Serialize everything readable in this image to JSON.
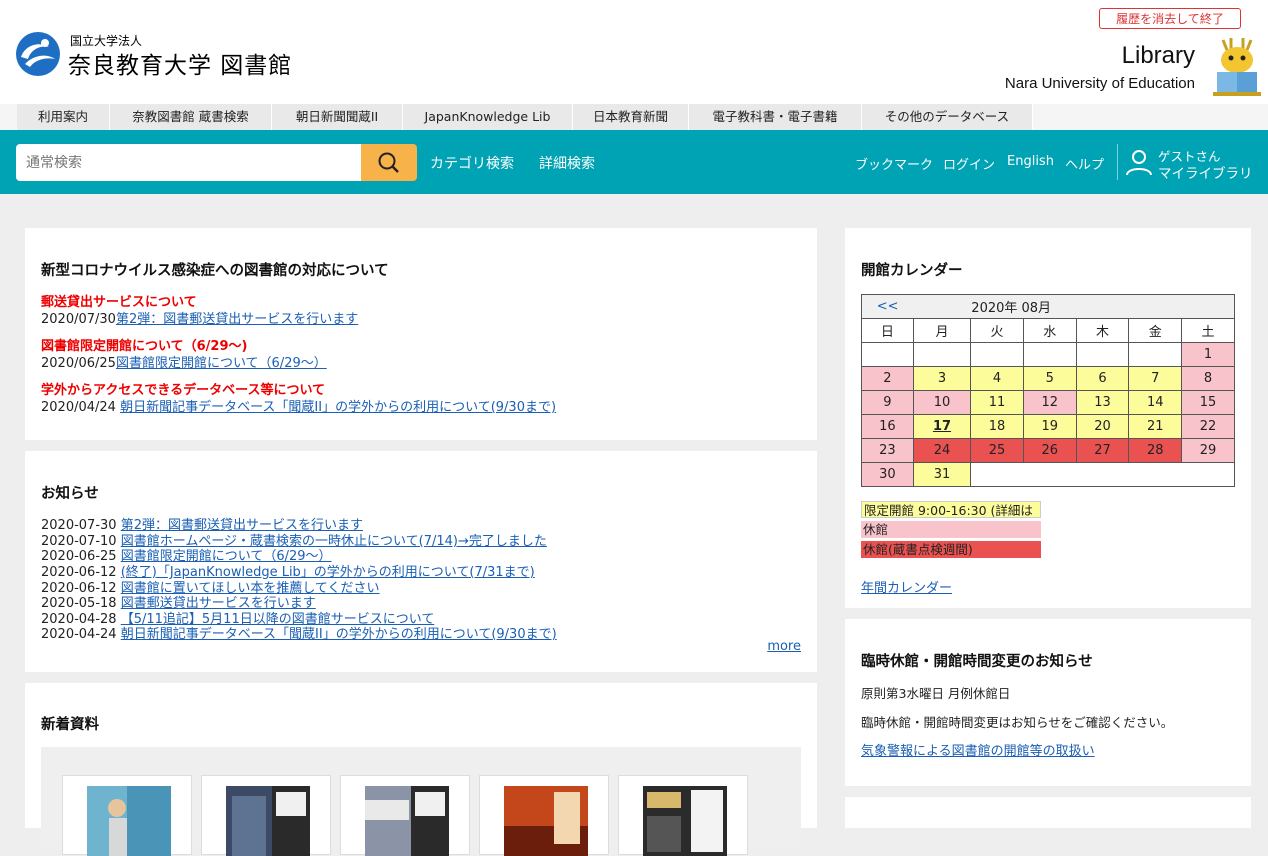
{
  "header": {
    "logo_small": "国立大学法人",
    "logo_big": "奈良教育大学 図書館",
    "clear_history": "履歴を消去して終了",
    "library_title": "Library",
    "library_subtitle": "Nara University of Education"
  },
  "db_tabs": [
    "利用案内",
    "奈教図書館 蔵書検索",
    "朝日新聞聞蔵II",
    "JapanKnowledge Lib",
    "日本教育新聞",
    "電子教科書・電子書籍",
    "その他のデータベース"
  ],
  "search": {
    "placeholder": "通常検索",
    "category": "カテゴリ検索",
    "advanced": "詳細検索",
    "bookmark": "ブックマーク",
    "login": "ログイン",
    "english": "English",
    "help": "ヘルプ",
    "guest": "ゲストさん",
    "mylibrary": "マイライブラリ"
  },
  "covid": {
    "title": "新型コロナウイルス感染症への図書館の対応について",
    "sections": [
      {
        "heading": "郵送貸出サービスについて",
        "date": "2020/07/30",
        "link": "第2弾：図書郵送貸出サービスを行います"
      },
      {
        "heading": "図書館限定開館について（6/29～)",
        "date": "2020/06/25",
        "link": "図書館限定開館について（6/29～）"
      },
      {
        "heading": "学外からアクセスできるデータベース等について",
        "date": "2020/04/24",
        "link": "朝日新聞記事データベース「聞蔵II」の学外からの利用について(9/30まで)"
      }
    ]
  },
  "news": {
    "title": "お知らせ",
    "items": [
      {
        "date": "2020-07-30",
        "text": "第2弾：図書郵送貸出サービスを行います"
      },
      {
        "date": "2020-07-10",
        "text": "図書館ホームページ・蔵書検索の一時休止について(7/14)→完了しました"
      },
      {
        "date": "2020-06-25",
        "text": "図書館限定開館について（6/29～）"
      },
      {
        "date": "2020-06-12",
        "text": "(終了)「JapanKnowledge Lib」の学外からの利用について(7/31まで)"
      },
      {
        "date": "2020-06-12",
        "text": "図書館に置いてほしい本を推薦してください"
      },
      {
        "date": "2020-05-18",
        "text": "図書郵送貸出サービスを行います"
      },
      {
        "date": "2020-04-28",
        "text": "【5/11追記】5月11日以降の図書館サービスについて"
      },
      {
        "date": "2020-04-24",
        "text": "朝日新聞記事データベース「聞蔵II」の学外からの利用について(9/30まで)"
      }
    ],
    "more": "more"
  },
  "new_materials": {
    "title": "新着資料"
  },
  "calendar": {
    "title": "開館カレンダー",
    "prev": "<<",
    "month_label": "2020年 08月",
    "weekdays": [
      "日",
      "月",
      "火",
      "水",
      "木",
      "金",
      "土"
    ],
    "weeks": [
      [
        {
          "d": "",
          "s": "w"
        },
        {
          "d": "",
          "s": "w"
        },
        {
          "d": "",
          "s": "w"
        },
        {
          "d": "",
          "s": "w"
        },
        {
          "d": "",
          "s": "w"
        },
        {
          "d": "",
          "s": "w"
        },
        {
          "d": "1",
          "s": "p"
        }
      ],
      [
        {
          "d": "2",
          "s": "p"
        },
        {
          "d": "3",
          "s": "y"
        },
        {
          "d": "4",
          "s": "y"
        },
        {
          "d": "5",
          "s": "y"
        },
        {
          "d": "6",
          "s": "y"
        },
        {
          "d": "7",
          "s": "y"
        },
        {
          "d": "8",
          "s": "p"
        }
      ],
      [
        {
          "d": "9",
          "s": "p"
        },
        {
          "d": "10",
          "s": "p"
        },
        {
          "d": "11",
          "s": "y"
        },
        {
          "d": "12",
          "s": "p"
        },
        {
          "d": "13",
          "s": "y"
        },
        {
          "d": "14",
          "s": "y"
        },
        {
          "d": "15",
          "s": "p"
        }
      ],
      [
        {
          "d": "16",
          "s": "p"
        },
        {
          "d": "17",
          "s": "y",
          "today": true
        },
        {
          "d": "18",
          "s": "y"
        },
        {
          "d": "19",
          "s": "y"
        },
        {
          "d": "20",
          "s": "y"
        },
        {
          "d": "21",
          "s": "y"
        },
        {
          "d": "22",
          "s": "p"
        }
      ],
      [
        {
          "d": "23",
          "s": "p"
        },
        {
          "d": "24",
          "s": "r"
        },
        {
          "d": "25",
          "s": "r"
        },
        {
          "d": "26",
          "s": "r"
        },
        {
          "d": "27",
          "s": "r"
        },
        {
          "d": "28",
          "s": "r"
        },
        {
          "d": "29",
          "s": "p"
        }
      ],
      [
        {
          "d": "30",
          "s": "p"
        },
        {
          "d": "31",
          "s": "y"
        },
        {
          "d": "",
          "s": "w",
          "span": 5
        }
      ]
    ],
    "legend": [
      {
        "label": "限定開館 9:00-16:30 (詳細は",
        "color": "#fdfc9a"
      },
      {
        "label": "休館",
        "color": "#f9c3cc"
      },
      {
        "label": "休館(蔵書点検週間)",
        "color": "#ea5252"
      }
    ],
    "annual_link": "年間カレンダー"
  },
  "closure": {
    "title": "臨時休館・開館時間変更のお知らせ",
    "line1": "原則第3水曜日 月例休館日",
    "line2": "臨時休館・開館時間変更はお知らせをご確認ください。",
    "link": "気象警報による図書館の開館等の取扱い"
  }
}
